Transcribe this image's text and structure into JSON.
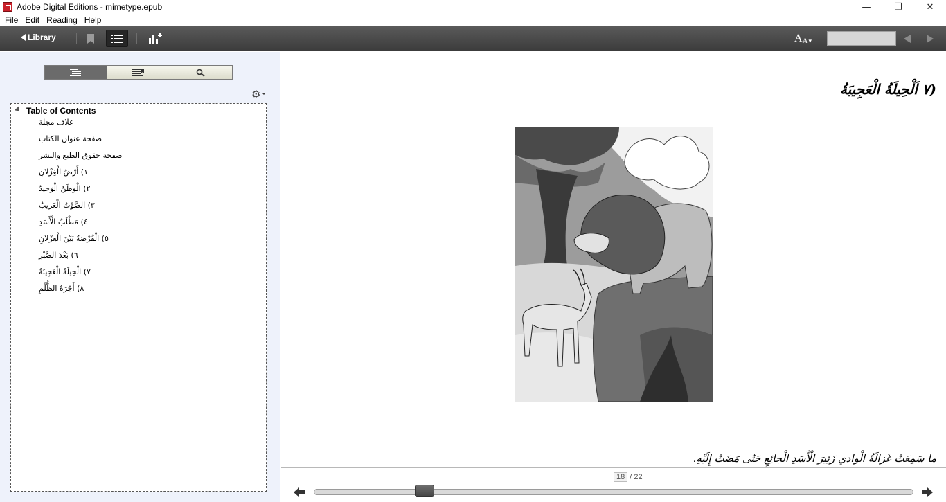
{
  "window": {
    "title": "Adobe Digital Editions - mimetype.epub",
    "controls": {
      "minimize": "—",
      "restore": "❐",
      "close": "✕"
    }
  },
  "menu": [
    {
      "label": "File",
      "accel": "F",
      "rest": "ile"
    },
    {
      "label": "Edit",
      "accel": "E",
      "rest": "dit"
    },
    {
      "label": "Reading",
      "accel": "R",
      "rest": "eading"
    },
    {
      "label": "Help",
      "accel": "H",
      "rest": "elp"
    }
  ],
  "toolbar": {
    "library_label": "Library",
    "font_label": "A",
    "search_value": "",
    "icons": {
      "bookmark": "bookmark-icon",
      "toc": "toc-list-icon",
      "stats": "add-stats-icon",
      "font": "font-size-icon",
      "prev": "prev-page-icon",
      "next": "next-page-icon"
    }
  },
  "sidebar": {
    "tabs": [
      "toc-tab-icon",
      "bookmarks-tab-icon",
      "search-tab-icon"
    ],
    "active_tab": 0,
    "gear": "gear-icon",
    "toc_header": "Table of Contents",
    "toc_items": [
      "غلاف مجلة",
      "صفحة عنوان الكتاب",
      "صفحة حقوق الطبع والنشر",
      "١) أَرْضُ الْغِزْلانِ",
      "٢) الْوَطَنُ الْوَحِيدُ",
      "٣) الصَّوْتُ الْغَرِيبُ",
      "٤) مَطْلَبُ الْأَسَدِ",
      "٥) الْفُرْصَةُ بَيْنَ الْغِزْلانِ",
      "٦) بَعْدَ الصَّبْرِ",
      "٧) الْحِيلَةُ الْعَجِيبَةُ",
      "٨) أَجْرَةُ الظُّلْمِ"
    ]
  },
  "reader": {
    "chapter_title": "(٧ اَلْحِيلَةُ الْعَجِيبَةُ",
    "illustration": "lion-and-gazelle-illustration",
    "caption": "ما سَمِعَتْ غَزالَةُ الْوادي زَئِيرَ الْأَسَدِ الْجائِعِ حَتّى مَضَتْ إِلَيْهِ."
  },
  "pagination": {
    "current": "18",
    "total": "/ 22",
    "progress": 0.174
  }
}
